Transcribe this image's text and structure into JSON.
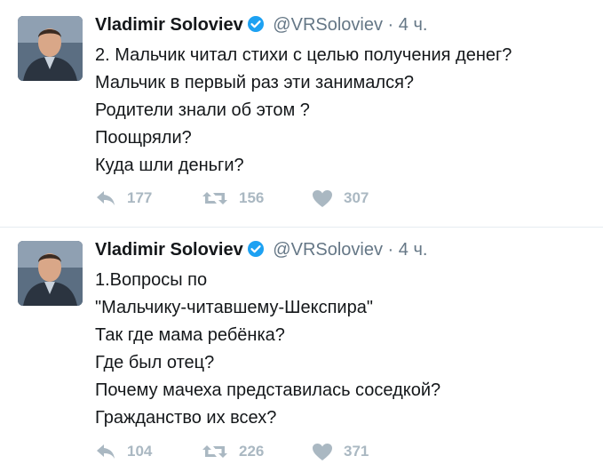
{
  "tweets": [
    {
      "author_name": "Vladimir Soloviev",
      "handle": "@VRSoloviev",
      "separator": "·",
      "time": "4 ч.",
      "lines": [
        "2. Мальчик читал стихи с целью получения денег?",
        "Мальчик в первый раз эти занимался?",
        "Родители знали об этом ?",
        "Поощряли?",
        "Куда шли деньги?"
      ],
      "replies": "177",
      "retweets": "156",
      "likes": "307"
    },
    {
      "author_name": "Vladimir Soloviev",
      "handle": "@VRSoloviev",
      "separator": "·",
      "time": "4 ч.",
      "lines": [
        "1.Вопросы по",
        "\"Мальчику-читавшему-Шекспира\"",
        "Так где мама ребёнка?",
        "Где был отец?",
        "Почему мачеха представилась соседкой?",
        "Гражданство их всех?"
      ],
      "replies": "104",
      "retweets": "226",
      "likes": "371"
    }
  ],
  "colors": {
    "text": "#14171a",
    "secondary": "#657786",
    "action_gray": "#aab8c2",
    "verified_blue": "#1da1f2",
    "divider": "#e6ecf0"
  },
  "icons": [
    "reply-icon",
    "retweet-icon",
    "heart-icon",
    "verified-badge-icon"
  ]
}
